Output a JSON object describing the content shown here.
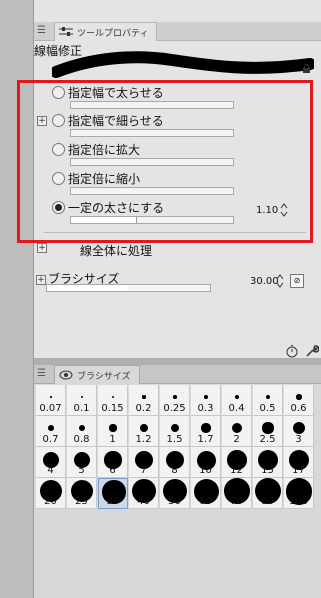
{
  "tool_property": {
    "tab_label": "ツールプロパティ",
    "section_title": "線幅修正",
    "options": [
      {
        "label": "指定幅で太らせる",
        "checked": false,
        "plus": false
      },
      {
        "label": "指定幅で細らせる",
        "checked": false,
        "plus": true
      },
      {
        "label": "指定倍に拡大",
        "checked": false,
        "plus": false
      },
      {
        "label": "指定倍に縮小",
        "checked": false,
        "plus": false
      },
      {
        "label": "一定の太さにする",
        "checked": true,
        "plus": false,
        "value": "1.10",
        "fill_fraction": 0.4
      }
    ],
    "partial_label": "線全体に処理",
    "brush_size_label": "ブラシサイズ",
    "brush_size_value": "30.00",
    "brush_size_fill_fraction": 0.5
  },
  "brush_size_panel": {
    "tab_label": "ブラシサイズ",
    "selected": "30",
    "sizes": [
      "0.07",
      "0.1",
      "0.15",
      "0.2",
      "0.25",
      "0.3",
      "0.4",
      "0.5",
      "0.6",
      "0.7",
      "0.8",
      "1",
      "1.2",
      "1.5",
      "1.7",
      "2",
      "2.5",
      "3",
      "4",
      "5",
      "6",
      "7",
      "8",
      "10",
      "12",
      "15",
      "17",
      "20",
      "25",
      "30",
      "40",
      "50",
      "60",
      "70",
      "80",
      "100"
    ]
  },
  "icons": {
    "tool_settings_tab": "sliders-icon",
    "brush_tab": "brush-icon",
    "lock": "lock-icon",
    "reset": "timer-icon",
    "settings": "wrench-icon"
  }
}
